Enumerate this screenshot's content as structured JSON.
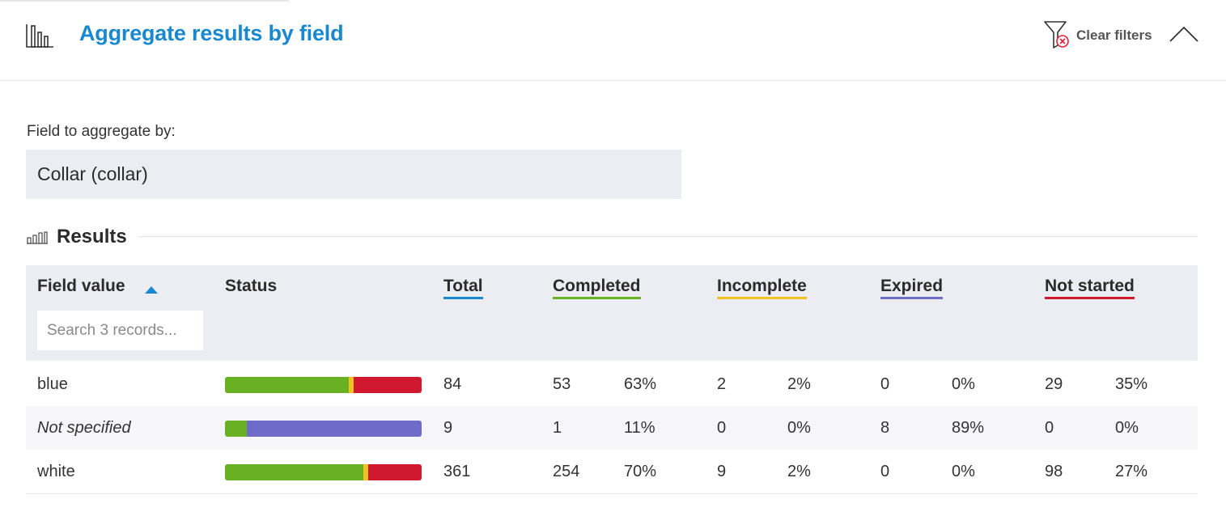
{
  "header": {
    "title": "Aggregate results by field",
    "clear_filters_label": "Clear filters",
    "icons": {
      "chart": "bar-chart-icon",
      "filter": "filter-clear-icon",
      "collapse": "chevron-up-icon"
    }
  },
  "field": {
    "label": "Field to aggregate by:",
    "selected": "Collar (collar)"
  },
  "results": {
    "title": "Results",
    "icon": "small-bar-chart-icon"
  },
  "table": {
    "columns": {
      "field_value": "Field value",
      "status": "Status",
      "total": "Total",
      "completed": "Completed",
      "incomplete": "Incomplete",
      "expired": "Expired",
      "not_started": "Not started"
    },
    "sort": {
      "column": "field_value",
      "direction": "ascending"
    },
    "search_placeholder": "Search 3 records...",
    "rows": [
      {
        "value": "blue",
        "italic": false,
        "total": "84",
        "completed": "53",
        "completed_pct": "63%",
        "incomplete": "2",
        "incomplete_pct": "2%",
        "expired": "0",
        "expired_pct": "0%",
        "not_started": "29",
        "not_started_pct": "35%"
      },
      {
        "value": "Not specified",
        "italic": true,
        "total": "9",
        "completed": "1",
        "completed_pct": "11%",
        "incomplete": "0",
        "incomplete_pct": "0%",
        "expired": "8",
        "expired_pct": "89%",
        "not_started": "0",
        "not_started_pct": "0%"
      },
      {
        "value": "white",
        "italic": false,
        "total": "361",
        "completed": "254",
        "completed_pct": "70%",
        "incomplete": "9",
        "incomplete_pct": "2%",
        "expired": "0",
        "expired_pct": "0%",
        "not_started": "98",
        "not_started_pct": "27%"
      }
    ]
  },
  "colors": {
    "accent": "#1a88cf",
    "total": "#1a88cf",
    "completed": "#6ab023",
    "incomplete": "#f2c31f",
    "expired": "#6f6bc8",
    "not_started": "#d0192f",
    "clear_icon": "#e0243a"
  }
}
